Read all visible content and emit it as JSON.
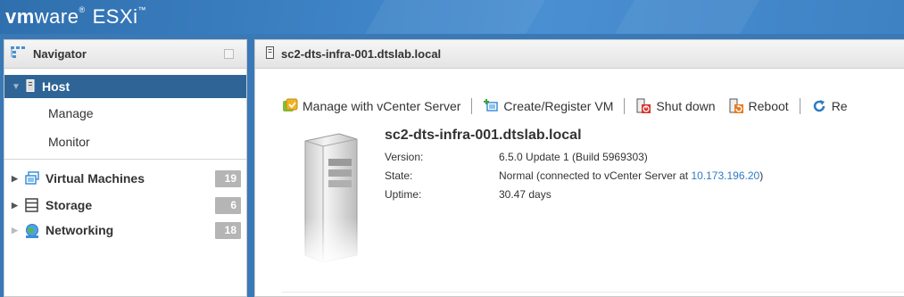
{
  "brand": {
    "vm": "vm",
    "ware": "ware",
    "product": "ESXi",
    "tm": "™"
  },
  "navigator": {
    "title": "Navigator",
    "host": {
      "label": "Host",
      "children": [
        "Manage",
        "Monitor"
      ]
    },
    "items": [
      {
        "label": "Virtual Machines",
        "count": "19",
        "icon": "virtual-machines-icon"
      },
      {
        "label": "Storage",
        "count": "6",
        "icon": "storage-icon"
      },
      {
        "label": "Networking",
        "count": "18",
        "icon": "networking-icon"
      }
    ]
  },
  "main": {
    "title": "sc2-dts-infra-001.dtslab.local",
    "toolbar": {
      "manage_vcenter": "Manage with vCenter Server",
      "create_vm": "Create/Register VM",
      "shut_down": "Shut down",
      "reboot": "Reboot",
      "refresh": "Re"
    },
    "host": {
      "name": "sc2-dts-infra-001.dtslab.local",
      "version_label": "Version:",
      "version_value": "6.5.0 Update 1 (Build 5969303)",
      "state_label": "State:",
      "state_value": "Normal (connected to vCenter Server at ",
      "state_link": "10.173.196.20",
      "state_suffix": ")",
      "uptime_label": "Uptime:",
      "uptime_value": "30.47 days"
    }
  },
  "colors": {
    "accent": "#2e6596",
    "link": "#2f7bc4",
    "badge": "#b5b5b5",
    "topbar": "#3f84c7"
  }
}
